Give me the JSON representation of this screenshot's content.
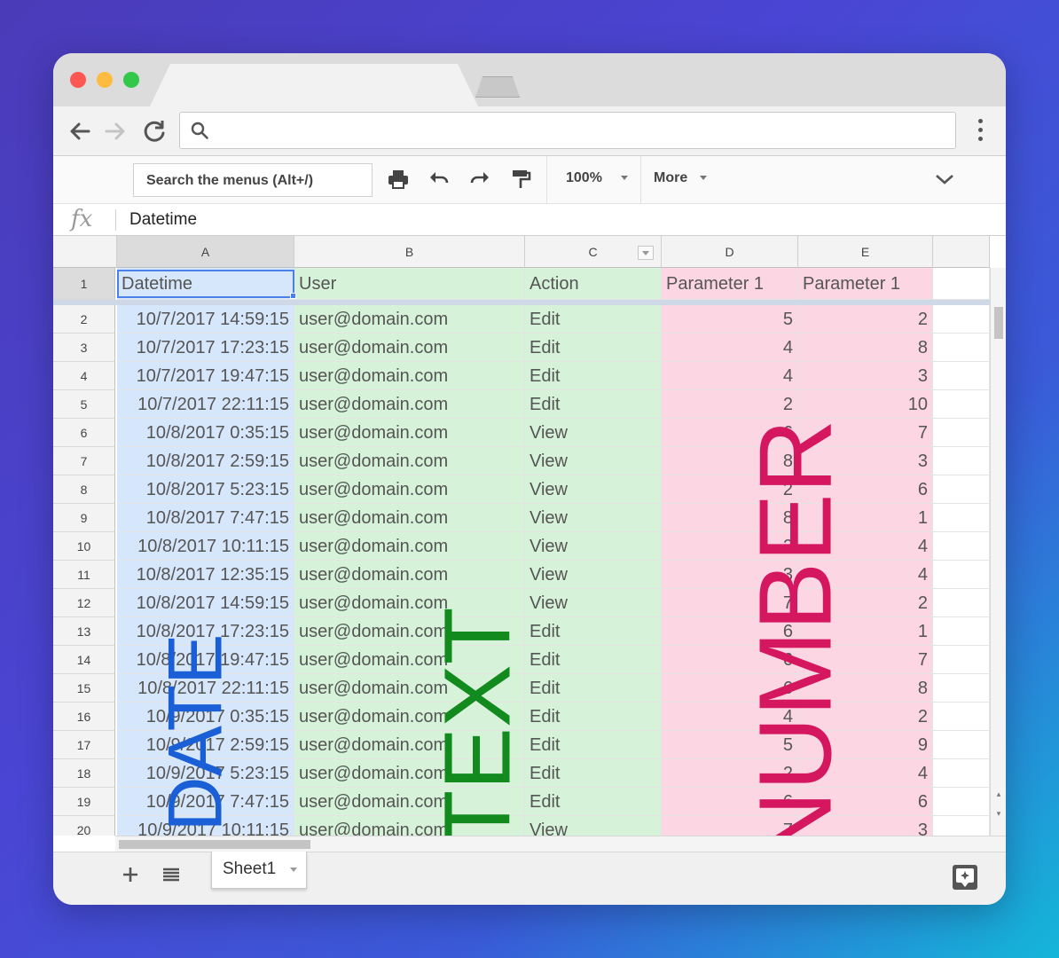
{
  "toolbar": {
    "menu_search_placeholder": "Search the menus (Alt+/)",
    "zoom": "100%",
    "more_label": "More"
  },
  "formula": {
    "fx_label": "fx",
    "value": "Datetime"
  },
  "columns": [
    "A",
    "B",
    "C",
    "D",
    "E"
  ],
  "header_row": [
    "Datetime",
    "User",
    "Action",
    "Parameter 1",
    "Parameter 1"
  ],
  "rows": [
    {
      "n": "2",
      "datetime": "10/7/2017 14:59:15",
      "user": "user@domain.com",
      "action": "Edit",
      "p1": "5",
      "p2": "2"
    },
    {
      "n": "3",
      "datetime": "10/7/2017 17:23:15",
      "user": "user@domain.com",
      "action": "Edit",
      "p1": "4",
      "p2": "8"
    },
    {
      "n": "4",
      "datetime": "10/7/2017 19:47:15",
      "user": "user@domain.com",
      "action": "Edit",
      "p1": "4",
      "p2": "3"
    },
    {
      "n": "5",
      "datetime": "10/7/2017 22:11:15",
      "user": "user@domain.com",
      "action": "Edit",
      "p1": "2",
      "p2": "10"
    },
    {
      "n": "6",
      "datetime": "10/8/2017 0:35:15",
      "user": "user@domain.com",
      "action": "View",
      "p1": "6",
      "p2": "7"
    },
    {
      "n": "7",
      "datetime": "10/8/2017 2:59:15",
      "user": "user@domain.com",
      "action": "View",
      "p1": "8",
      "p2": "3"
    },
    {
      "n": "8",
      "datetime": "10/8/2017 5:23:15",
      "user": "user@domain.com",
      "action": "View",
      "p1": "2",
      "p2": "6"
    },
    {
      "n": "9",
      "datetime": "10/8/2017 7:47:15",
      "user": "user@domain.com",
      "action": "View",
      "p1": "8",
      "p2": "1"
    },
    {
      "n": "10",
      "datetime": "10/8/2017 10:11:15",
      "user": "user@domain.com",
      "action": "View",
      "p1": "2",
      "p2": "4"
    },
    {
      "n": "11",
      "datetime": "10/8/2017 12:35:15",
      "user": "user@domain.com",
      "action": "View",
      "p1": "3",
      "p2": "4"
    },
    {
      "n": "12",
      "datetime": "10/8/2017 14:59:15",
      "user": "user@domain.com",
      "action": "View",
      "p1": "7",
      "p2": "2"
    },
    {
      "n": "13",
      "datetime": "10/8/2017 17:23:15",
      "user": "user@domain.com",
      "action": "Edit",
      "p1": "6",
      "p2": "1"
    },
    {
      "n": "14",
      "datetime": "10/8/2017 19:47:15",
      "user": "user@domain.com",
      "action": "Edit",
      "p1": "6",
      "p2": "7"
    },
    {
      "n": "15",
      "datetime": "10/8/2017 22:11:15",
      "user": "user@domain.com",
      "action": "Edit",
      "p1": "6",
      "p2": "8"
    },
    {
      "n": "16",
      "datetime": "10/9/2017 0:35:15",
      "user": "user@domain.com",
      "action": "Edit",
      "p1": "4",
      "p2": "2"
    },
    {
      "n": "17",
      "datetime": "10/9/2017 2:59:15",
      "user": "user@domain.com",
      "action": "Edit",
      "p1": "5",
      "p2": "9"
    },
    {
      "n": "18",
      "datetime": "10/9/2017 5:23:15",
      "user": "user@domain.com",
      "action": "Edit",
      "p1": "2",
      "p2": "4"
    },
    {
      "n": "19",
      "datetime": "10/9/2017 7:47:15",
      "user": "user@domain.com",
      "action": "Edit",
      "p1": "6",
      "p2": "6"
    },
    {
      "n": "20",
      "datetime": "10/9/2017 10:11:15",
      "user": "user@domain.com",
      "action": "View",
      "p1": "7",
      "p2": "3"
    }
  ],
  "overlays": {
    "date": "DATE",
    "text": "TEXT",
    "number": "NUMBER"
  },
  "colors": {
    "date_fill": "#d6e6fb",
    "text_fill": "#d6f2d9",
    "number_fill": "#fdd6e4",
    "date_label": "#1a5fd6",
    "text_label": "#128a1e",
    "number_label": "#d4175f"
  },
  "sheet_tabs": [
    "Sheet1"
  ]
}
